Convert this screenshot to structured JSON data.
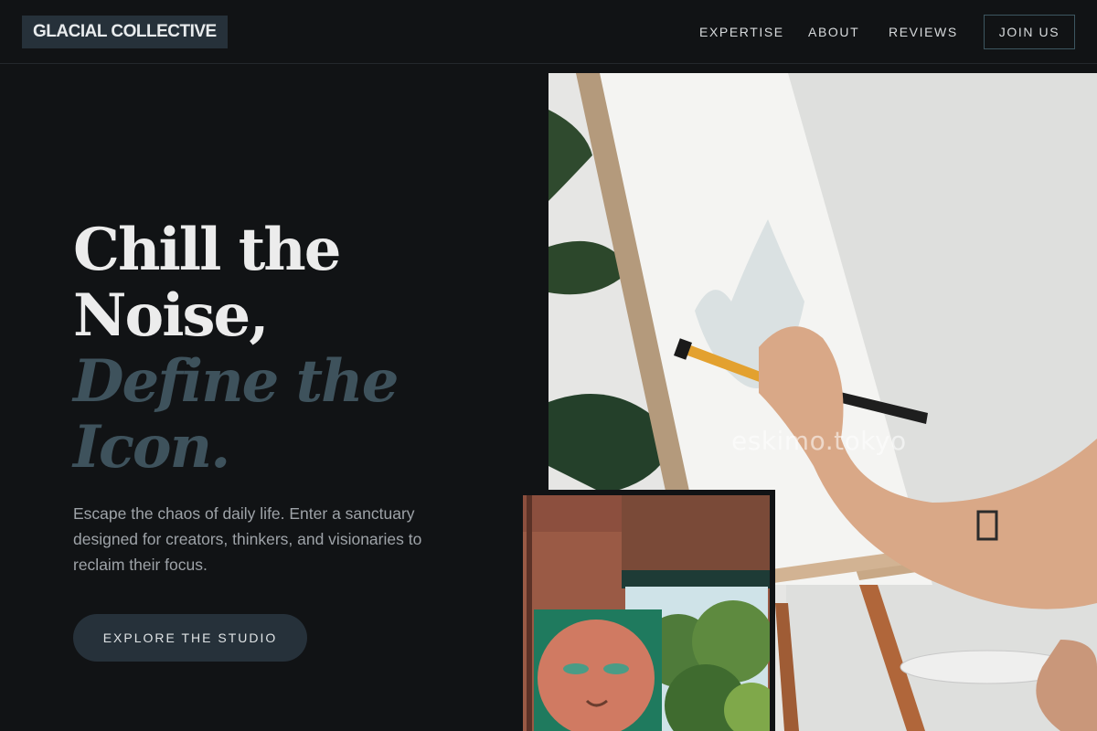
{
  "brand": {
    "logo_text": "GLACIAL COLLECTIVE"
  },
  "nav": {
    "links": [
      {
        "label": "EXPERTISE"
      },
      {
        "label": "ABOUT"
      },
      {
        "label": "REVIEWS"
      }
    ],
    "join_label": "JOIN US"
  },
  "hero": {
    "headline_line1": "Chill the",
    "headline_line2": "Noise,",
    "headline_line3": "Define the",
    "headline_line4": "Icon.",
    "subtext": "Escape the chaos of daily life. Enter a sanctuary designed for creators, thinkers, and visionaries to reclaim their focus.",
    "cta_label": "EXPLORE THE STUDIO",
    "watermark": "eskimo.tokyo"
  },
  "colors": {
    "background": "#111315",
    "accent": "#26313a",
    "headline_light": "#ececec",
    "headline_muted": "#3e525c"
  }
}
